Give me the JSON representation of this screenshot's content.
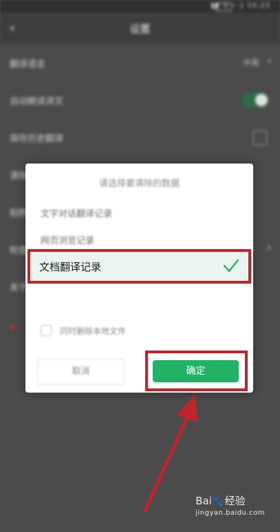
{
  "status_bar": {
    "right_text": "▮▮ ⊙ ⌁ ▯ 10:23"
  },
  "header": {
    "back_icon": "‹",
    "title": "设置"
  },
  "settings": [
    {
      "label": "翻译语言",
      "value": "中英",
      "control": "chevron"
    },
    {
      "label": "自动朗读译文",
      "control": "toggle-on"
    },
    {
      "label": "保存历史翻译",
      "control": "checkbox"
    },
    {
      "label": "清除缓存",
      "control": "none"
    },
    {
      "label": "拍照翻译",
      "control": "none"
    },
    {
      "label": "检查更新",
      "control": "chevron"
    },
    {
      "label": "关于",
      "control": "none"
    }
  ],
  "dialog": {
    "title": "请选择要清除的数据",
    "options": [
      {
        "label": "文字对话翻译记录",
        "selected": false
      },
      {
        "label": "网页浏览记录",
        "selected": false
      },
      {
        "label": "文档翻译记录",
        "selected": true
      }
    ],
    "delete_local_label": "同时删除本地文件",
    "cancel_label": "取消",
    "confirm_label": "确定"
  },
  "colors": {
    "accent": "#20b365",
    "annotation": "#c3242b"
  },
  "watermark": {
    "brand": "Bai",
    "brand_suffix": "经验",
    "url": "jingyan.baidu.com"
  }
}
